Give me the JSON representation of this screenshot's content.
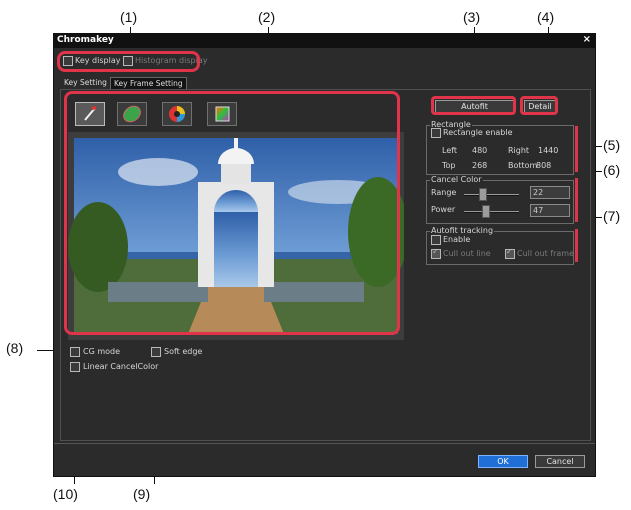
{
  "callouts": {
    "c1": "(1)",
    "c2": "(2)",
    "c3": "(3)",
    "c4": "(4)",
    "c5": "(5)",
    "c6": "(6)",
    "c7": "(7)",
    "c8": "(8)",
    "c9": "(9)",
    "c10": "(10)"
  },
  "window": {
    "title": "Chromakey",
    "close": "×"
  },
  "top_options": {
    "key_display": "Key display",
    "histogram_display": "Histogram display"
  },
  "tabs": [
    "Key Setting",
    "Key Frame Setting"
  ],
  "tools": [
    "eyedropper-tool-icon",
    "ellipse-key-tool-icon",
    "color-wheel-tool-icon",
    "gradient-square-tool-icon"
  ],
  "buttons": {
    "autofit": "Autofit",
    "detail": "Detail",
    "ok": "OK",
    "cancel": "Cancel"
  },
  "rectangle": {
    "title": "Rectangle",
    "enable_label": "Rectangle enable",
    "left_label": "Left",
    "left_value": "480",
    "right_label": "Right",
    "right_value": "1440",
    "top_label": "Top",
    "top_value": "268",
    "bottom_label": "Bottom",
    "bottom_value": "808"
  },
  "cancel_color": {
    "title": "Cancel Color",
    "range_label": "Range",
    "range_value": "22",
    "power_label": "Power",
    "power_value": "47"
  },
  "autofit_tracking": {
    "title": "Autofit tracking",
    "enable_label": "Enable",
    "cull_out_line": "Cull out line",
    "cull_out_frame": "Cull out frame"
  },
  "bottom_options": {
    "cg_mode": "CG mode",
    "soft_edge": "Soft edge",
    "linear_cancel_color": "Linear CancelColor"
  },
  "colors": {
    "highlight": "#e0344a",
    "ok_button": "#1f6fd6"
  }
}
